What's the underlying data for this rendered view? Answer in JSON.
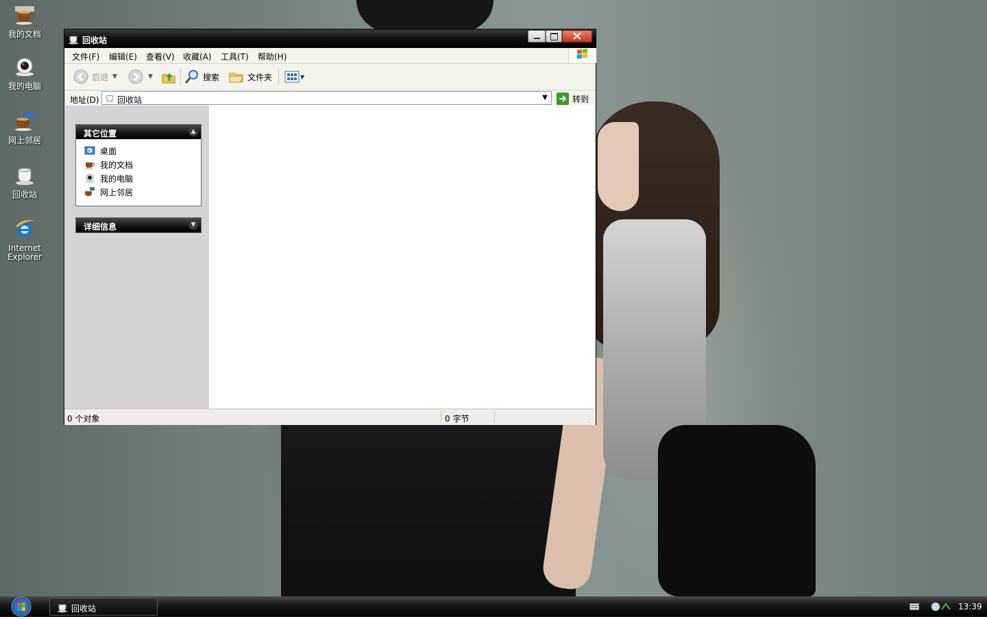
{
  "desktop": {
    "icons": [
      {
        "label": "我的文档"
      },
      {
        "label": "我的电脑"
      },
      {
        "label": "网上邻居"
      },
      {
        "label": "回收站"
      },
      {
        "label": "Internet\nExplorer"
      }
    ]
  },
  "window": {
    "title": "回收站",
    "menu": [
      "文件(F)",
      "编辑(E)",
      "查看(V)",
      "收藏(A)",
      "工具(T)",
      "帮助(H)"
    ],
    "toolbar": {
      "back_label": "后退",
      "search_label": "搜索",
      "folders_label": "文件夹"
    },
    "address": {
      "label": "地址(D)",
      "value": "回收站",
      "go_label": "转到"
    },
    "left_pane": {
      "other_places": {
        "title": "其它位置",
        "items": [
          "桌面",
          "我的文档",
          "我的电脑",
          "网上邻居"
        ]
      },
      "details": {
        "title": "详细信息"
      }
    },
    "status": {
      "objects": "0 个对象",
      "bytes": "0 字节"
    }
  },
  "taskbar": {
    "window_button": "回收站",
    "clock": "13:39"
  },
  "colors": {
    "titlebar": "#000000",
    "menu_bg": "#f4f3ee",
    "left_pane": "#d4d4d4",
    "close_btn": "#c2351c",
    "xp_logo_red": "#f35325",
    "xp_logo_green": "#81bc06",
    "xp_logo_blue": "#05a6f0",
    "xp_logo_yellow": "#ffba08"
  }
}
